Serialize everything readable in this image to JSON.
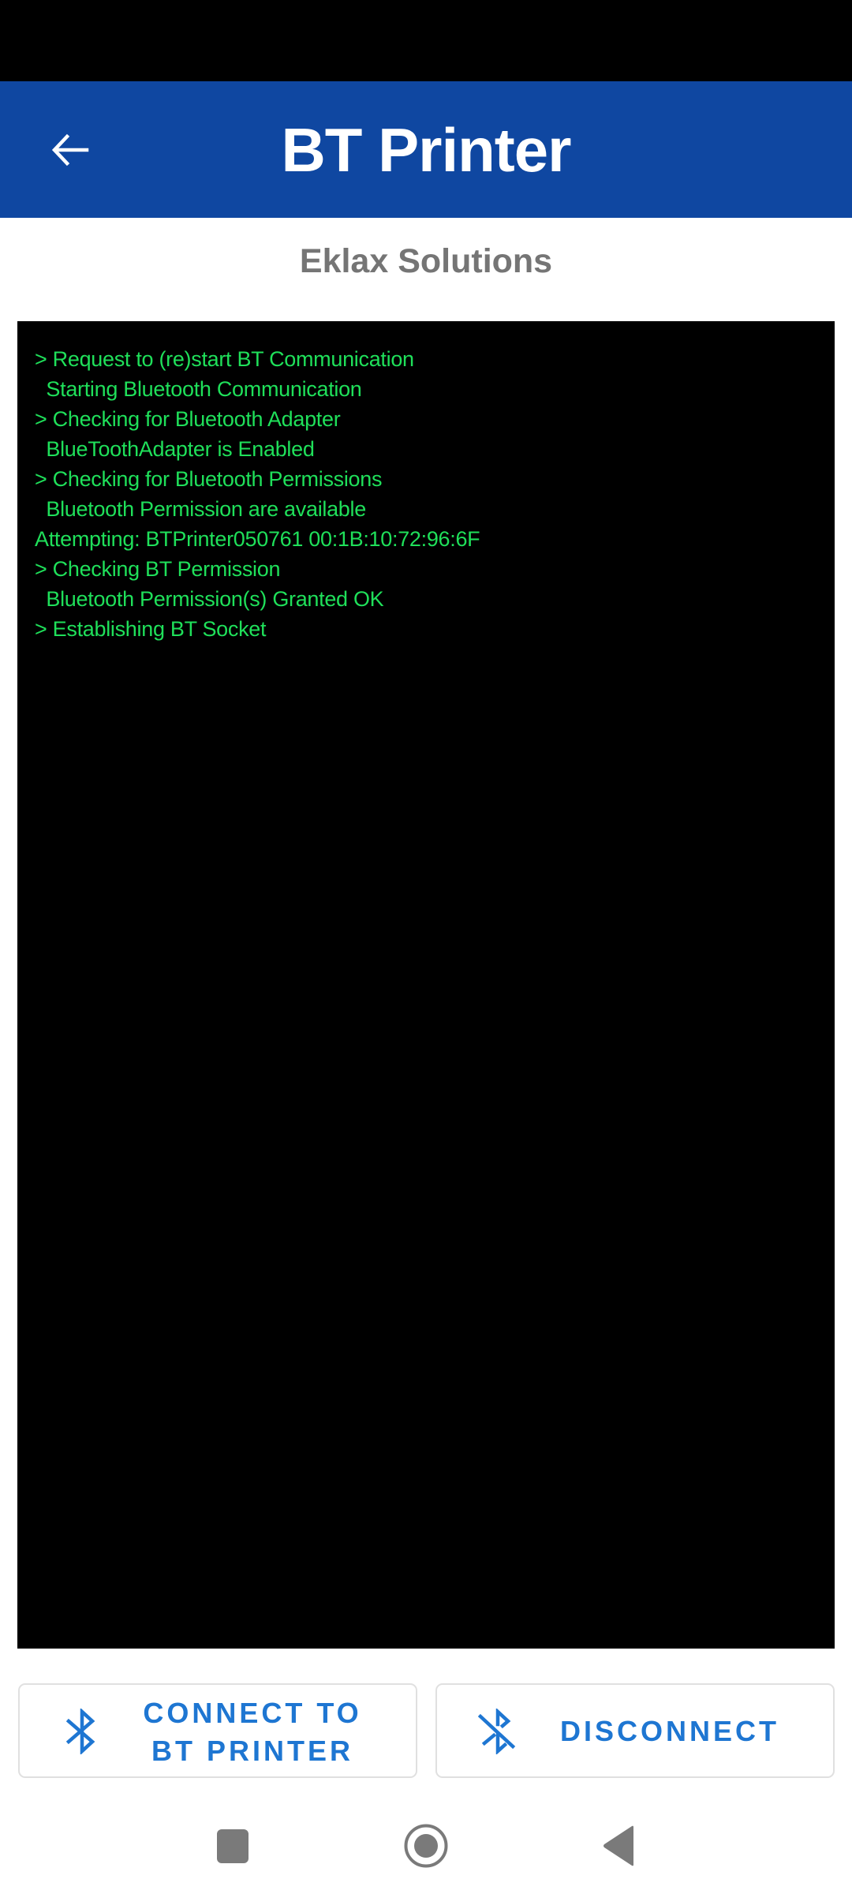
{
  "app_bar": {
    "title": "BT Printer",
    "back_icon": "arrow-left-icon"
  },
  "subtitle": "Eklax Solutions",
  "colors": {
    "app_bar": "#0F47A1",
    "console_bg": "#000000",
    "console_text": "#1FE05A",
    "button_text": "#1E76D2",
    "subtitle": "#757575"
  },
  "console": {
    "lines": [
      "> Request to (re)start BT Communication",
      "  Starting Bluetooth Communication",
      "> Checking for Bluetooth Adapter",
      "  BlueToothAdapter is Enabled",
      "> Checking for Bluetooth Permissions",
      "  Bluetooth Permission are available",
      "Attempting: BTPrinter050761 00:1B:10:72:96:6F",
      "> Checking BT Permission",
      "  Bluetooth Permission(s) Granted OK",
      "> Establishing BT Socket"
    ]
  },
  "buttons": {
    "connect": {
      "label_line1": "CONNECT TO",
      "label_line2": "BT PRINTER",
      "icon": "bluetooth-icon"
    },
    "disconnect": {
      "label": "DISCONNECT",
      "icon": "bluetooth-disabled-icon"
    }
  },
  "nav_bar": {
    "recents": "recents-square-icon",
    "home": "home-circle-icon",
    "back": "back-triangle-icon"
  }
}
